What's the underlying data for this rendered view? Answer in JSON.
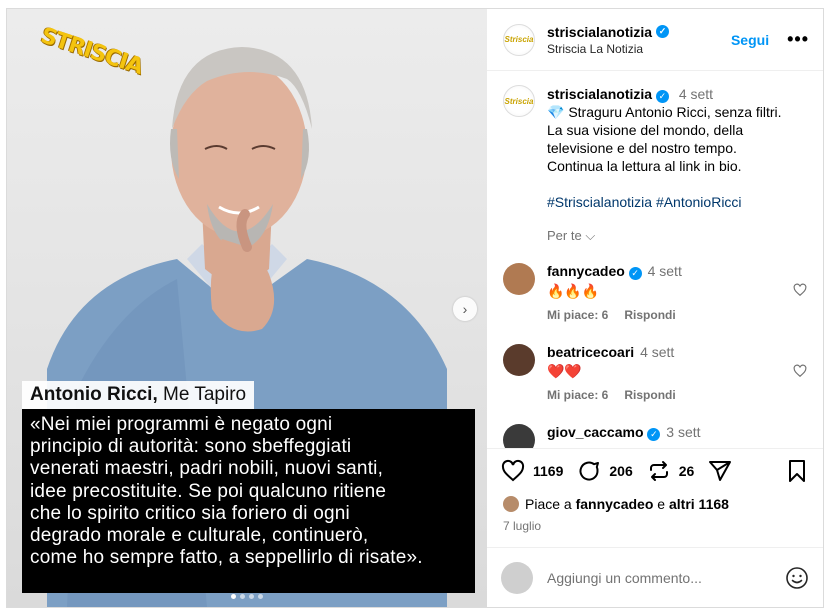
{
  "media": {
    "logo_text": "STRISCIA",
    "caption_name": "Antonio Ricci,",
    "caption_rest": "Me Tapiro",
    "quote_lines": [
      "«Nei miei programmi è negato ogni",
      "principio di autorità: sono sbeffeggiati",
      "venerati maestri, padri nobili, nuovi santi,",
      "idee precostituite. Se poi qualcuno ritiene",
      "che lo spirito critico sia foriero di ogni",
      "degrado morale e culturale, continuerò,",
      "come ho sempre fatto, a seppellirlo di risate»."
    ],
    "next_icon": "chevron-right-icon",
    "slides": 4,
    "active_slide": 1
  },
  "header": {
    "username": "strisciala­notizia",
    "display_name": "Striscia La Notizia",
    "follow_label": "Segui",
    "more_label": "•••",
    "avatar_text": "Striscia"
  },
  "post": {
    "username": "strisciala­notizia",
    "time": "4 sett",
    "line1": "💎 Straguru Antonio Ricci, senza filtri.",
    "line2": "La sua visione del mondo, della",
    "line3": "televisione e del nostro tempo.",
    "line4": "Continua la lettura al link in bio.",
    "hashtags": "#Strisciala­notizia #AntonioRicci",
    "translation_label": "Per te"
  },
  "comments": [
    {
      "username": "fannycadeo",
      "verified": true,
      "time": "4 sett",
      "text": "🔥🔥🔥",
      "likes": "Mi piace: 6",
      "reply": "Rispondi",
      "color": "#b07a52"
    },
    {
      "username": "beatricecoari",
      "verified": false,
      "time": "4 sett",
      "text": "❤️❤️",
      "likes": "Mi piace: 6",
      "reply": "Rispondi",
      "color": "#5a3b2c"
    },
    {
      "username": "giov_caccamo",
      "verified": true,
      "time": "3 sett",
      "text": "",
      "likes": "",
      "reply": "",
      "color": "#3a3a3a"
    }
  ],
  "actions": {
    "like_count": "1169",
    "comment_count": "206",
    "repost_count": "26"
  },
  "likes_line": {
    "prefix": "Piace a",
    "user": "fannycadeo",
    "mid": "e",
    "others": "altri 1168"
  },
  "date": "7 luglio",
  "add_comment": {
    "placeholder": "Aggiungi un commento...",
    "emoji_icon": "smiley-icon"
  }
}
